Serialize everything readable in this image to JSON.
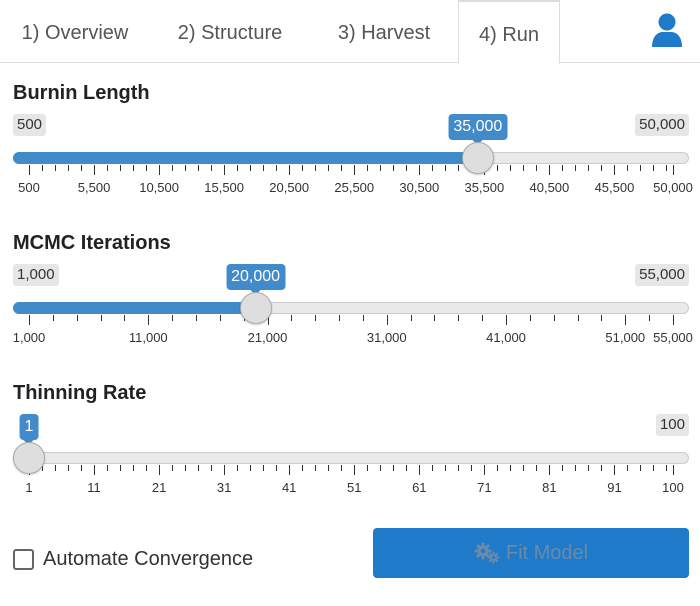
{
  "tabs": [
    {
      "label": "1) Overview",
      "active": false
    },
    {
      "label": "2) Structure",
      "active": false
    },
    {
      "label": "3) Harvest",
      "active": false
    },
    {
      "label": "4) Run",
      "active": true
    }
  ],
  "user_icon": "user-icon",
  "sliders": [
    {
      "label": "Burnin Length",
      "min": 500,
      "max": 50000,
      "value": 35000,
      "min_label": "500",
      "max_label": "50,000",
      "value_label": "35,000",
      "major_ticks": [
        500,
        5500,
        10500,
        15500,
        20500,
        25500,
        30500,
        35500,
        40500,
        45500,
        50000
      ],
      "tick_labels": [
        "500",
        "5,500",
        "10,500",
        "15,500",
        "20,500",
        "25,500",
        "30,500",
        "35,500",
        "40,500",
        "45,500",
        "50,000"
      ]
    },
    {
      "label": "MCMC Iterations",
      "min": 1000,
      "max": 55000,
      "value": 20000,
      "min_label": "1,000",
      "max_label": "55,000",
      "value_label": "20,000",
      "major_ticks": [
        1000,
        11000,
        21000,
        31000,
        41000,
        51000,
        55000
      ],
      "tick_labels": [
        "1,000",
        "11,000",
        "21,000",
        "31,000",
        "41,000",
        "51,000",
        "55,000"
      ]
    },
    {
      "label": "Thinning Rate",
      "min": 1,
      "max": 100,
      "value": 1,
      "min_label": "",
      "max_label": "100",
      "value_label": "1",
      "major_ticks": [
        1,
        11,
        21,
        31,
        41,
        51,
        61,
        71,
        81,
        91,
        100
      ],
      "tick_labels": [
        "1",
        "11",
        "21",
        "31",
        "41",
        "51",
        "61",
        "71",
        "81",
        "91",
        "100"
      ]
    }
  ],
  "automate_convergence": {
    "label": "Automate Convergence",
    "checked": false
  },
  "fit_button": {
    "label": "Fit Model",
    "icon": "gears-icon"
  },
  "colors": {
    "accent": "#428bca",
    "button": "#1f7ac9",
    "button_text": "#6b8aa8"
  }
}
